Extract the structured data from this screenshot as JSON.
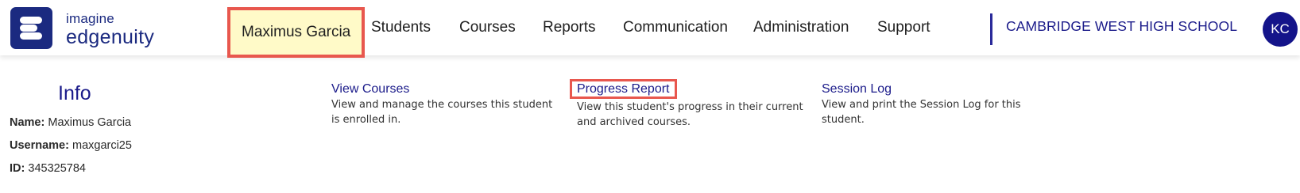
{
  "brand": {
    "line1": "imagine",
    "line2": "edgenuity"
  },
  "nav": [
    {
      "label": "Maximus Garcia",
      "active": true
    },
    {
      "label": "Students"
    },
    {
      "label": "Courses"
    },
    {
      "label": "Reports"
    },
    {
      "label": "Communication"
    },
    {
      "label": "Administration"
    },
    {
      "label": "Support"
    }
  ],
  "school": "CAMBRIDGE WEST HIGH SCHOOL",
  "avatar": "KC",
  "info": {
    "title": "Info",
    "rows": [
      {
        "label": "Name:",
        "value": "Maximus Garcia"
      },
      {
        "label": "Username:",
        "value": "maxgarci25"
      },
      {
        "label": "ID:",
        "value": "345325784"
      }
    ]
  },
  "cards": [
    {
      "title": "View Courses",
      "desc": "View and manage the courses this student is enrolled in."
    },
    {
      "title": "Progress Report",
      "desc": "View this student's progress in their current and archived courses.",
      "highlighted": true
    },
    {
      "title": "Session Log",
      "desc": "View and print the Session Log for this student."
    }
  ],
  "colors": {
    "brand": "#1b2a80",
    "highlight_border": "#e8574e",
    "active_bg": "#fffac8",
    "link": "#1b1b8a"
  }
}
